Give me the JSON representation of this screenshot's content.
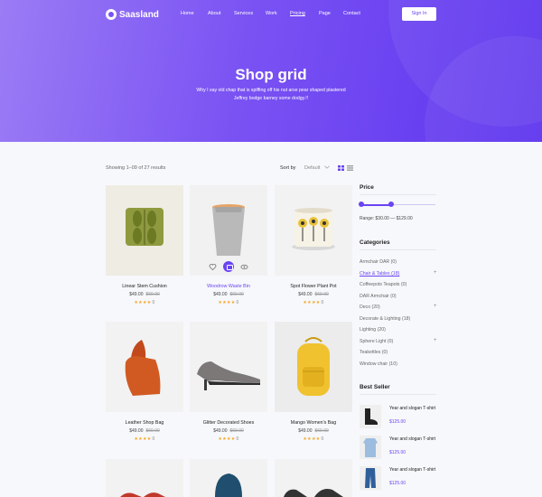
{
  "brand": {
    "name": "Saasland"
  },
  "nav": {
    "items": [
      "Home",
      "About",
      "Services",
      "Work",
      "Pricing",
      "Page",
      "Contact"
    ],
    "signin_label": "Sign In"
  },
  "hero": {
    "title": "Shop grid",
    "subtitle": "Why I say old chap that is spiffing off his nut arse pear shaped plastered Jeffrey bodge barney some dodgy.!!"
  },
  "toolbar": {
    "results": "Showing 1–09 of 27 results",
    "sort_label": "Sort by",
    "sort_value": "Default"
  },
  "products": [
    {
      "name": "Linear Stem Cushion",
      "price": "$49.00",
      "old_price": "$69.00",
      "stars": "★★★★",
      "count": "0"
    },
    {
      "name": "Woodrow Waste Bin",
      "price": "$49.00",
      "old_price": "$69.00",
      "stars": "★★★★",
      "count": "0"
    },
    {
      "name": "Spot Flower Plant Pot",
      "price": "$49.00",
      "old_price": "$69.00",
      "stars": "★★★★",
      "count": "0"
    },
    {
      "name": "Leather Shop Bag",
      "price": "$49.00",
      "old_price": "$69.00",
      "stars": "★★★★",
      "count": "0"
    },
    {
      "name": "Glitter Decorated Shoes",
      "price": "$49.00",
      "old_price": "$69.00",
      "stars": "★★★★",
      "count": "0"
    },
    {
      "name": "Mango Women's Bag",
      "price": "$49.00",
      "old_price": "$69.00",
      "stars": "★★★★",
      "count": "0"
    }
  ],
  "sidebar": {
    "price_heading": "Price",
    "range_text": "Range: $30.00 — $129.00",
    "categories_heading": "Categories",
    "categories": [
      "Armchair DAR (0)",
      "Chair & Tables (18)",
      "Coffeepots Teapots (0)",
      "DAR Armchair (0)",
      "Deco (20)",
      "Decorate & Lighting (18)",
      "Lighting (20)",
      "Sphere Light (0)",
      "Teakettles (0)",
      "Window chair (10)"
    ],
    "best_seller_heading": "Best Seller",
    "best_sellers": [
      {
        "title": "Year and slogan T-shirt",
        "price": "$125.00"
      },
      {
        "title": "Year and slogan T-shirt",
        "price": "$125.00"
      },
      {
        "title": "Year and slogan T-shirt",
        "price": "$125.00"
      }
    ]
  },
  "colors": {
    "accent": "#6a44f2",
    "hero_start": "#9b7cf5",
    "hero_end": "#5d34ef",
    "star": "#f5a623"
  }
}
